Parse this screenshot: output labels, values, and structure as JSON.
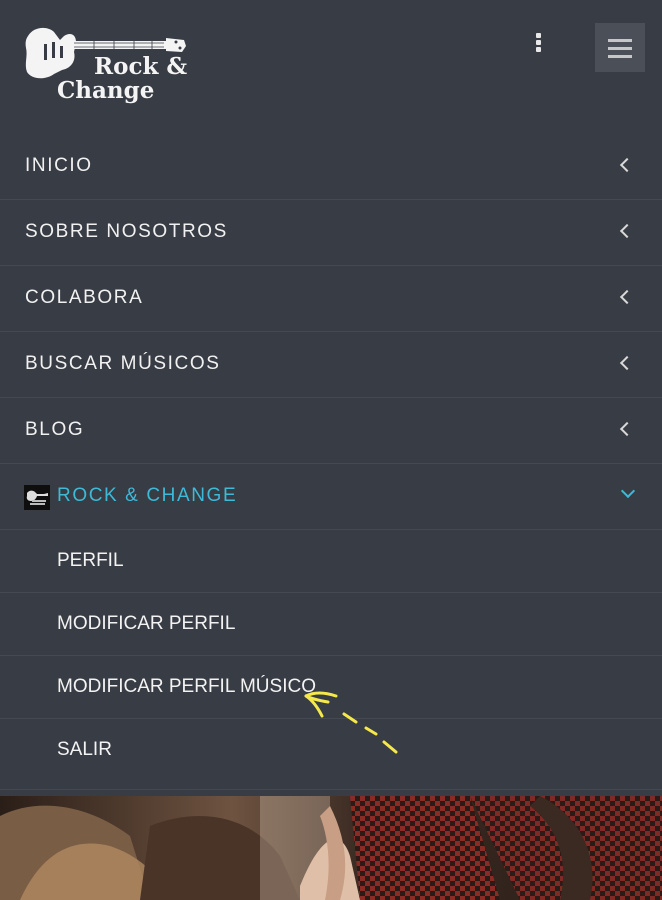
{
  "brand": {
    "logo_line1": "Rock &",
    "logo_line2": "Change"
  },
  "header": {
    "more_icon": "kebab-vertical-icon",
    "menu_icon": "hamburger-icon"
  },
  "menu": {
    "items": [
      {
        "label": "INICIO"
      },
      {
        "label": "SOBRE NOSOTROS"
      },
      {
        "label": "COLABORA"
      },
      {
        "label": "BUSCAR MÚSICOS"
      },
      {
        "label": "BLOG"
      }
    ],
    "active": {
      "label": "ROCK & CHANGE",
      "accent": "#3dbad6",
      "submenu": [
        {
          "label": "PERFIL"
        },
        {
          "label": "MODIFICAR PERFIL"
        },
        {
          "label": "MODIFICAR PERFIL MÚSICO"
        },
        {
          "label": "SALIR"
        }
      ]
    }
  },
  "annotation": {
    "color": "#f5e84a",
    "icon": "hand-drawn-arrow-icon"
  },
  "colors": {
    "background": "#383c44",
    "divider": "#444952",
    "text": "#f1f1f1"
  }
}
